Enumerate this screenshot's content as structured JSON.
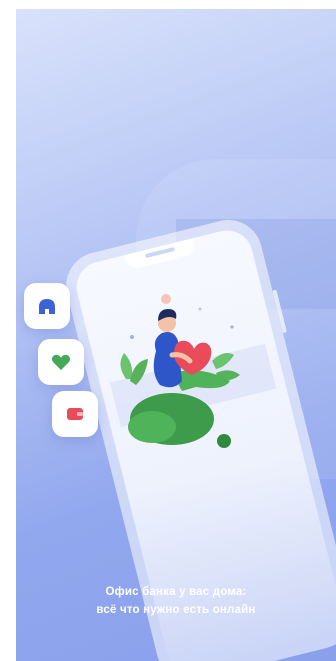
{
  "onboarding": {
    "caption_line1": "Офис банка у вас дома:",
    "caption_line2": "всё что нужно есть онлайн"
  },
  "icons": {
    "card1": "home-icon",
    "card2": "heart-icon",
    "card3": "wallet-icon",
    "illustration": "person-hugging-heart-illustration"
  },
  "colors": {
    "background_top": "#d9e2fb",
    "background_bottom": "#8aa0eb",
    "home_icon": "#3b63d6",
    "heart_icon": "#46a957",
    "wallet_icon": "#ea4b5b",
    "caption_text": "#ffffff"
  }
}
